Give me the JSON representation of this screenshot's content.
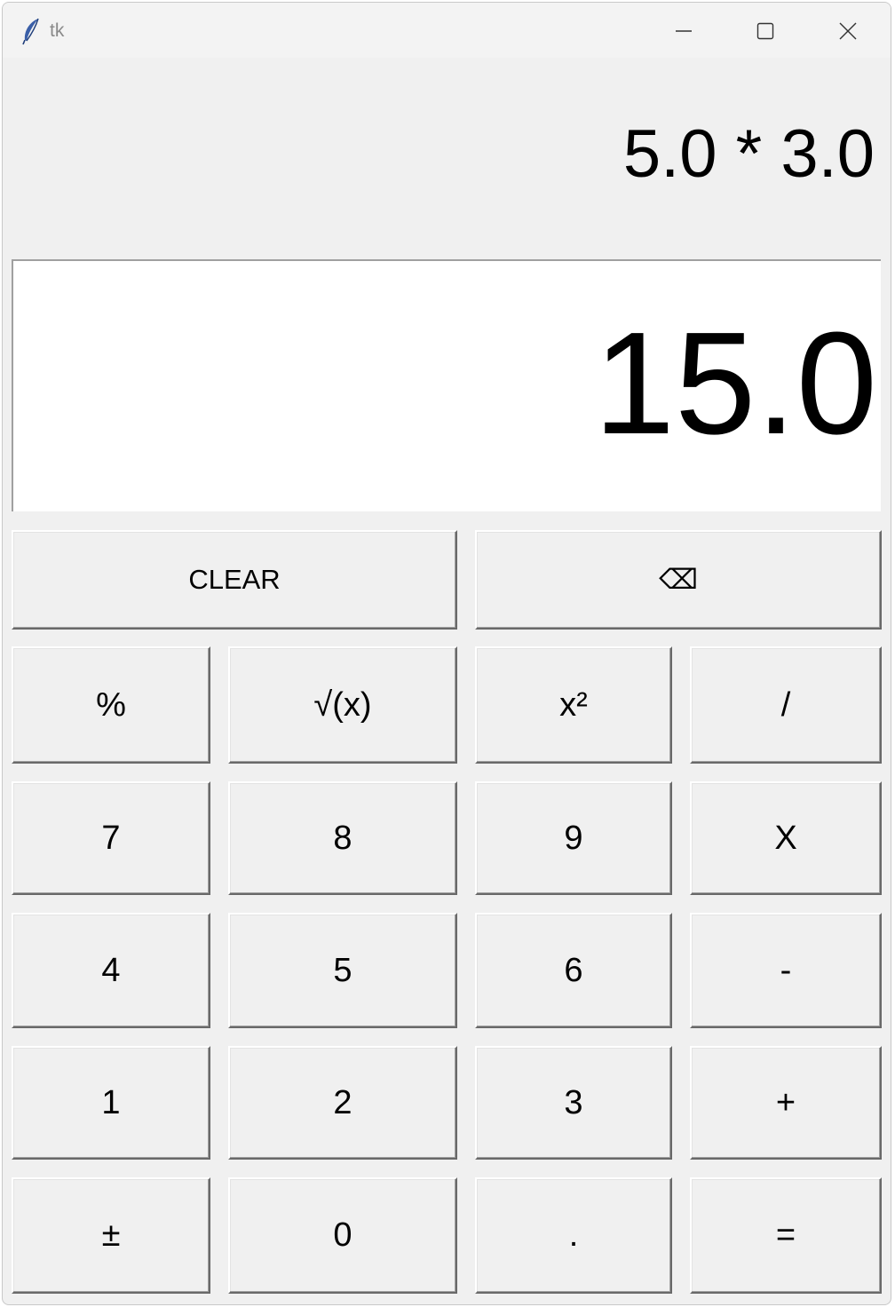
{
  "window": {
    "title": "tk",
    "icon": "feather-icon",
    "controls": [
      "minimize-icon",
      "maximize-icon",
      "close-icon"
    ]
  },
  "expression": "5.0 * 3.0",
  "display": {
    "value": "15.0"
  },
  "keys": {
    "clear": "CLEAR",
    "backspace": "⌫",
    "percent": "%",
    "sqrt": "√(x)",
    "square": "x²",
    "divide": "/",
    "seven": "7",
    "eight": "8",
    "nine": "9",
    "multiply": "X",
    "four": "4",
    "five": "5",
    "six": "6",
    "minus": "-",
    "one": "1",
    "two": "2",
    "three": "3",
    "plus": "+",
    "negate": "±",
    "zero": "0",
    "decimal": ".",
    "equals": "="
  }
}
